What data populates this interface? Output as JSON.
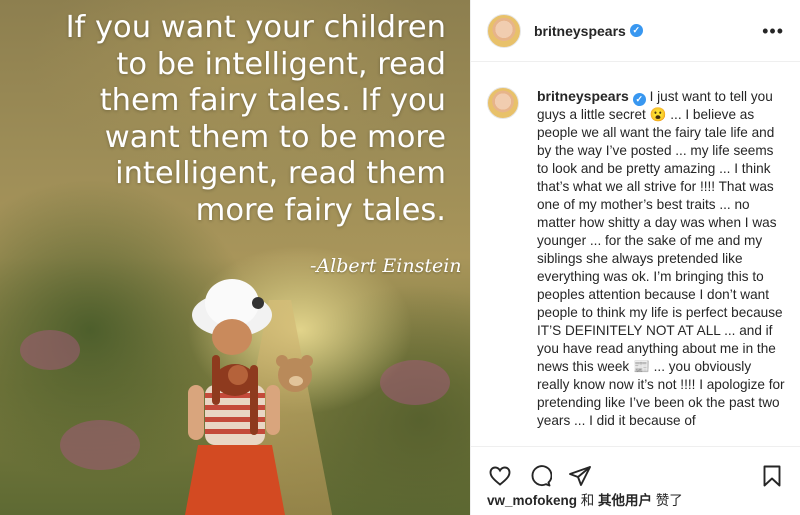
{
  "post": {
    "quote": "If you want your children\nto be intelligent, read\nthem fairy tales. If you\nwant them to be more\nintelligent, read them\nmore fairy tales.",
    "signature": "-Albert Einstein"
  },
  "header": {
    "username": "britneyspears",
    "verified_icon": "verified-badge-icon",
    "more_icon": "more-options-icon",
    "more_label": "•••"
  },
  "caption": {
    "username": "britneyspears",
    "text": " I just want to tell you guys a little secret 😮 ... I believe as people we all want the fairy tale life and by the way I’ve posted ... my life seems to look and be pretty amazing ... I think that’s what we all strive for !!!! That was one of my mother’s best traits ... no matter how shitty a day was when I was younger ... for the sake of me and my siblings she always pretended like everything was ok. I’m bringing this to peoples attention because I don’t want people to think my life is perfect because IT’S DEFINITELY NOT AT ALL ... and if you have read anything about me in the news this week 📰 ... you obviously really know now it’s not !!!! I apologize for pretending like I’ve been ok the past two years ... I did it because of"
  },
  "actions": {
    "like_icon": "heart-icon",
    "comment_icon": "comment-icon",
    "share_icon": "paper-plane-icon",
    "save_icon": "bookmark-icon"
  },
  "likes": {
    "user": "vw_mofokeng",
    "separator": " 和 ",
    "others": "其他用户",
    "suffix": " 赞了"
  },
  "colors": {
    "verified": "#3897f0",
    "text": "#262626",
    "border": "#efefef"
  }
}
